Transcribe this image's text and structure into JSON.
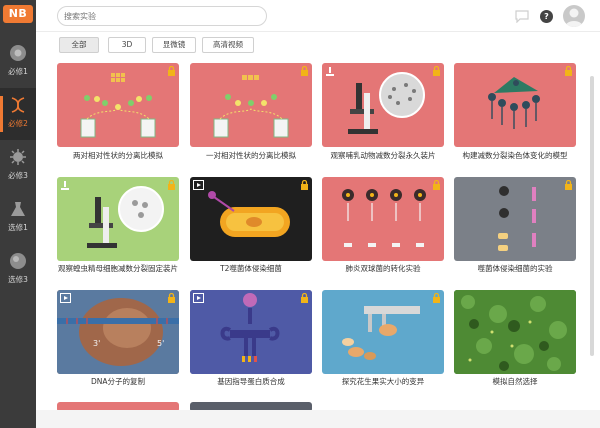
{
  "app": {
    "logo": "NB"
  },
  "sidebar": {
    "items": [
      {
        "label": "必修1",
        "icon": "cell-icon",
        "active": false
      },
      {
        "label": "必修2",
        "icon": "dna-icon",
        "active": true
      },
      {
        "label": "必修3",
        "icon": "virus-icon",
        "active": false
      },
      {
        "label": "选修1",
        "icon": "flask-icon",
        "active": false
      },
      {
        "label": "选修3",
        "icon": "molecule-icon",
        "active": false
      }
    ]
  },
  "header": {
    "search_placeholder": "搜索实验",
    "help_label": "?"
  },
  "filters": [
    {
      "label": "全部",
      "active": true
    },
    {
      "label": "3D",
      "active": false
    },
    {
      "label": "显微镜",
      "active": false
    },
    {
      "label": "高清视频",
      "active": false
    }
  ],
  "cards": [
    {
      "title": "两对相对性状的分离比模拟",
      "bg": "#e47676",
      "badge": "none",
      "locked": true
    },
    {
      "title": "一对相对性状的分离比模拟",
      "bg": "#e47676",
      "badge": "none",
      "locked": true
    },
    {
      "title": "观察哺乳动物减数分裂永久装片",
      "bg": "#e47676",
      "badge": "microscope",
      "locked": true
    },
    {
      "title": "构建减数分裂染色体变化的模型",
      "bg": "#e47676",
      "badge": "none",
      "locked": true
    },
    {
      "title": "观察蝗虫精母细胞减数分裂固定装片",
      "bg": "#a8d27a",
      "badge": "microscope",
      "locked": true
    },
    {
      "title": "T2噬菌体侵染细菌",
      "bg": "#1f1f1f",
      "badge": "video",
      "locked": true
    },
    {
      "title": "肺炎双球菌的转化实验",
      "bg": "#e47676",
      "badge": "none",
      "locked": true
    },
    {
      "title": "噬菌体侵染细菌的实验",
      "bg": "#7b8088",
      "badge": "none",
      "locked": true
    },
    {
      "title": "DNA分子的复制",
      "bg": "#8a5a3a",
      "badge": "video",
      "locked": true
    },
    {
      "title": "基因指导蛋白质合成",
      "bg": "#5b5fa8",
      "badge": "video",
      "locked": true
    },
    {
      "title": "探究花生果实大小的变异",
      "bg": "#5fa8cc",
      "badge": "none",
      "locked": true
    },
    {
      "title": "模拟自然选择",
      "bg": "#3e7a2a",
      "badge": "none",
      "locked": false
    }
  ],
  "colors": {
    "accent": "#f07a33",
    "sidebar": "#3b3b3b",
    "lock": "#f2b418"
  },
  "dna_labels": {
    "left": "3'",
    "right": "5'"
  }
}
